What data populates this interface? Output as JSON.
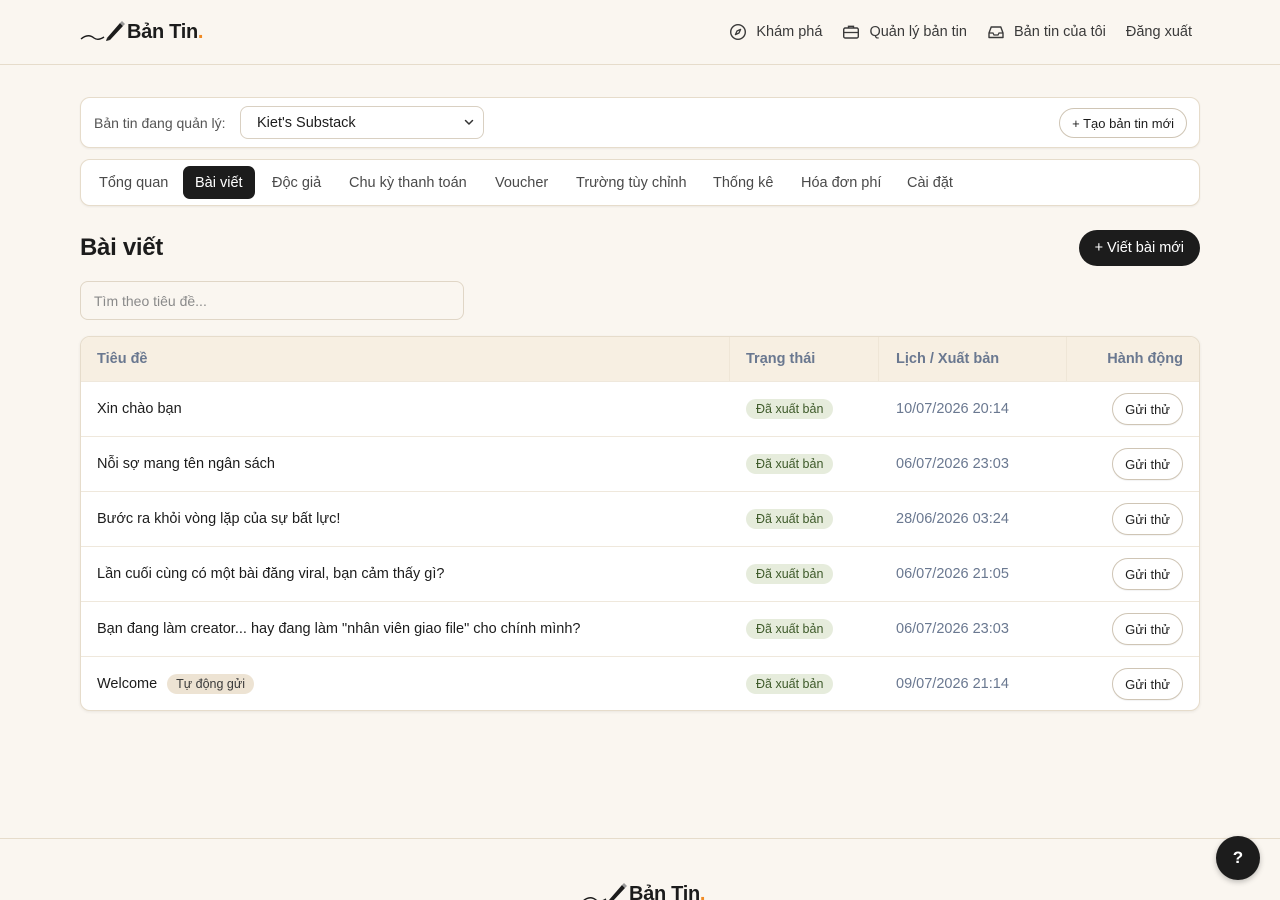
{
  "brand": {
    "name": "Bản Tin",
    "dot": "."
  },
  "topnav": [
    {
      "label": "Khám phá",
      "icon": "compass-icon"
    },
    {
      "label": "Quản lý bản tin",
      "icon": "briefcase-icon"
    },
    {
      "label": "Bản tin của tôi",
      "icon": "inbox-icon"
    },
    {
      "label": "Đăng xuất",
      "icon": ""
    }
  ],
  "selector": {
    "label": "Bản tin đang quản lý:",
    "selected": "Kiet's Substack",
    "new_button": "+ Tạo bản tin mới"
  },
  "tabs": [
    {
      "label": "Tổng quan",
      "active": false
    },
    {
      "label": "Bài viết",
      "active": true
    },
    {
      "label": "Độc giả",
      "active": false
    },
    {
      "label": "Chu kỳ thanh toán",
      "active": false
    },
    {
      "label": "Voucher",
      "active": false
    },
    {
      "label": "Trường tùy chỉnh",
      "active": false
    },
    {
      "label": "Thống kê",
      "active": false
    },
    {
      "label": "Hóa đơn phí",
      "active": false
    },
    {
      "label": "Cài đặt",
      "active": false
    }
  ],
  "page": {
    "title": "Bài viết",
    "new_post_button": "+ Viết bài mới",
    "search_placeholder": "Tìm theo tiêu đề..."
  },
  "table": {
    "headers": [
      "Tiêu đề",
      "Trạng thái",
      "Lịch / Xuất bản",
      "Hành động"
    ],
    "rows": [
      {
        "title": "Xin chào bạn",
        "tag": "",
        "status": "Đã xuất bản",
        "date": "10/07/2026 20:14",
        "action": "Gửi thử"
      },
      {
        "title": "Nỗi sợ mang tên ngân sách",
        "tag": "",
        "status": "Đã xuất bản",
        "date": "06/07/2026 23:03",
        "action": "Gửi thử"
      },
      {
        "title": "Bước ra khỏi vòng lặp của sự bất lực!",
        "tag": "",
        "status": "Đã xuất bản",
        "date": "28/06/2026 03:24",
        "action": "Gửi thử"
      },
      {
        "title": "Lần cuối cùng có một bài đăng viral, bạn cảm thấy gì?",
        "tag": "",
        "status": "Đã xuất bản",
        "date": "06/07/2026 21:05",
        "action": "Gửi thử"
      },
      {
        "title": "Bạn đang làm creator... hay đang làm \"nhân viên giao file\" cho chính mình?",
        "tag": "",
        "status": "Đã xuất bản",
        "date": "06/07/2026 23:03",
        "action": "Gửi thử"
      },
      {
        "title": "Welcome",
        "tag": "Tự động gửi",
        "status": "Đã xuất bản",
        "date": "09/07/2026 21:14",
        "action": "Gửi thử"
      }
    ]
  },
  "help": {
    "label": "?"
  },
  "colors": {
    "accent_dot": "#f08a24",
    "dark": "#1c1c1c",
    "status_bg": "#e6ecdc"
  }
}
